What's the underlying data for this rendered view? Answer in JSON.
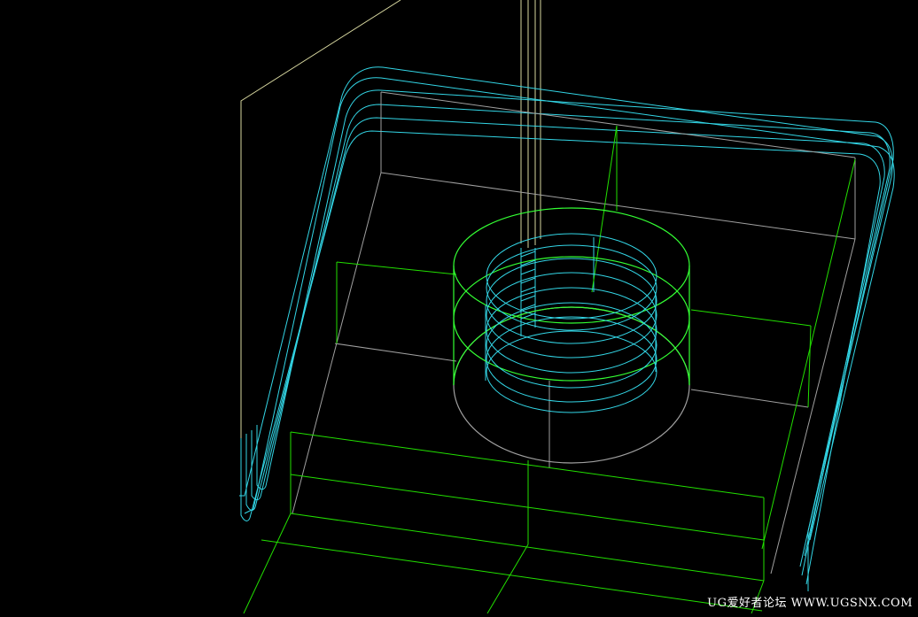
{
  "viewport": {
    "background": "#000000",
    "colors": {
      "outline": "#d8d8a0",
      "toolpath": "#33d6e6",
      "part_green": "#22e000",
      "edge_gray": "#a0a0a0",
      "circle_green": "#33ff33"
    }
  },
  "watermark": {
    "text": "UG爱好者论坛 WWW.UGSNX.COM"
  }
}
